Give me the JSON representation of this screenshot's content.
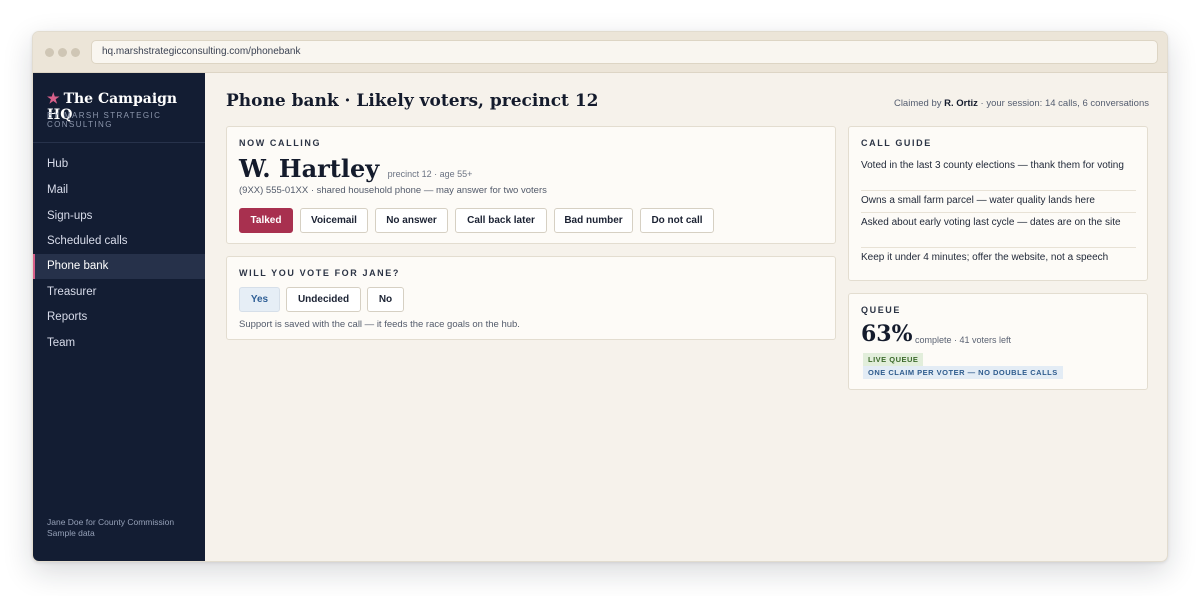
{
  "browser": {
    "url": "hq.marshstrategicconsulting.com/phonebank"
  },
  "sidebar": {
    "brand_star": "★",
    "brand_title": "The Campaign HQ",
    "brand_subtitle": "BY MARSH STRATEGIC CONSULTING",
    "items": [
      {
        "label": "Hub"
      },
      {
        "label": "Mail"
      },
      {
        "label": "Sign-ups"
      },
      {
        "label": "Scheduled calls"
      },
      {
        "label": "Phone bank",
        "active": true
      },
      {
        "label": "Treasurer"
      },
      {
        "label": "Reports"
      },
      {
        "label": "Team"
      }
    ],
    "footer_line1": "Jane Doe for County Commission",
    "footer_line2": "Sample data"
  },
  "header": {
    "title": "Phone bank · Likely voters, precinct 12",
    "claimed_prefix": "Claimed by",
    "claimed_name": "R. Ortiz",
    "claimed_suffix": "· your session: 14 calls, 6 conversations"
  },
  "now_calling": {
    "kicker": "NOW CALLING",
    "voter_name": "W. Hartley",
    "voter_meta": "precinct 12 · age 55+",
    "phone_line": "(9XX) 555-01XX · shared household phone — may answer for two voters",
    "outcomes": [
      {
        "label": "Talked",
        "selected": true
      },
      {
        "label": "Voicemail"
      },
      {
        "label": "No answer"
      },
      {
        "label": "Call back later"
      },
      {
        "label": "Bad number"
      },
      {
        "label": "Do not call"
      }
    ]
  },
  "support": {
    "kicker": "WILL YOU VOTE FOR JANE?",
    "options": [
      {
        "label": "Yes",
        "selected": true
      },
      {
        "label": "Undecided"
      },
      {
        "label": "No"
      }
    ],
    "note": "Support is saved with the call — it feeds the race goals on the hub."
  },
  "call_guide": {
    "kicker": "CALL GUIDE",
    "items": [
      "Voted in the last 3 county elections — thank them for voting",
      "Owns a small farm parcel — water quality lands here",
      "Asked about early voting last cycle — dates are on the site",
      "Keep it under 4 minutes; offer the website, not a speech"
    ]
  },
  "queue": {
    "kicker": "QUEUE",
    "percent_label": "63%",
    "percent_value": 63,
    "meta": "complete · 41 voters left",
    "badge_live": "LIVE QUEUE",
    "badge_rule": "ONE CLAIM PER VOTER — NO DOUBLE CALLS"
  },
  "colors": {
    "sidebar_bg": "#131d33",
    "accent": "#a8304f",
    "accent_pink": "#d7608a",
    "page_bg": "#f6f2eb",
    "selected_blue": "#2f5f96"
  }
}
